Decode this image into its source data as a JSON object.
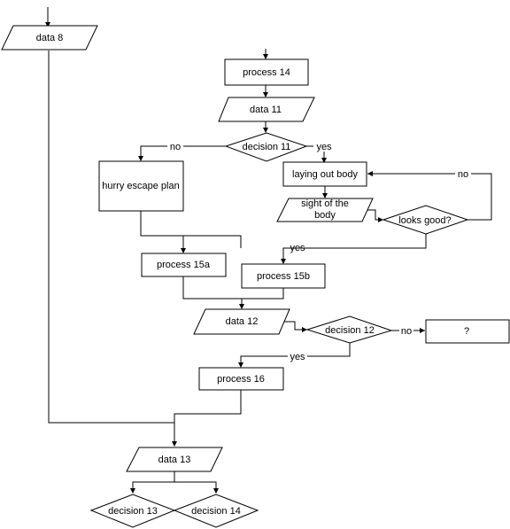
{
  "diagram": {
    "nodes": {
      "data_8": {
        "label": "data  8",
        "type": "data"
      },
      "process_14": {
        "label": "process  14",
        "type": "process"
      },
      "data_11": {
        "label": "data 11",
        "type": "data"
      },
      "decision_11": {
        "label": "decision 11",
        "type": "decision"
      },
      "hurry_escape_plan": {
        "label": "hurry escape plan",
        "type": "process"
      },
      "laying_out_body": {
        "label": "laying out body",
        "type": "process"
      },
      "sight_of_body_line1": {
        "label": "sight of the",
        "type": "data"
      },
      "sight_of_body_line2": {
        "label": "body",
        "type": "data"
      },
      "looks_good": {
        "label": "looks good?",
        "type": "decision"
      },
      "process_15a": {
        "label": "process  15a",
        "type": "process"
      },
      "process_15b": {
        "label": "process  15b",
        "type": "process"
      },
      "data_12": {
        "label": "data 12",
        "type": "data"
      },
      "decision_12": {
        "label": "decision 12",
        "type": "decision"
      },
      "unknown": {
        "label": "?",
        "type": "process"
      },
      "process_16": {
        "label": "process  16",
        "type": "process"
      },
      "data_13": {
        "label": "data 13",
        "type": "data"
      },
      "decision_13": {
        "label": "decision 13",
        "type": "decision"
      },
      "decision_14": {
        "label": "decision 14",
        "type": "decision"
      }
    },
    "edges": {
      "d11_no": "no",
      "d11_yes": "yes",
      "looks_no": "no",
      "looks_yes": "yes",
      "d12_no": "no",
      "d12_yes": "yes"
    }
  }
}
